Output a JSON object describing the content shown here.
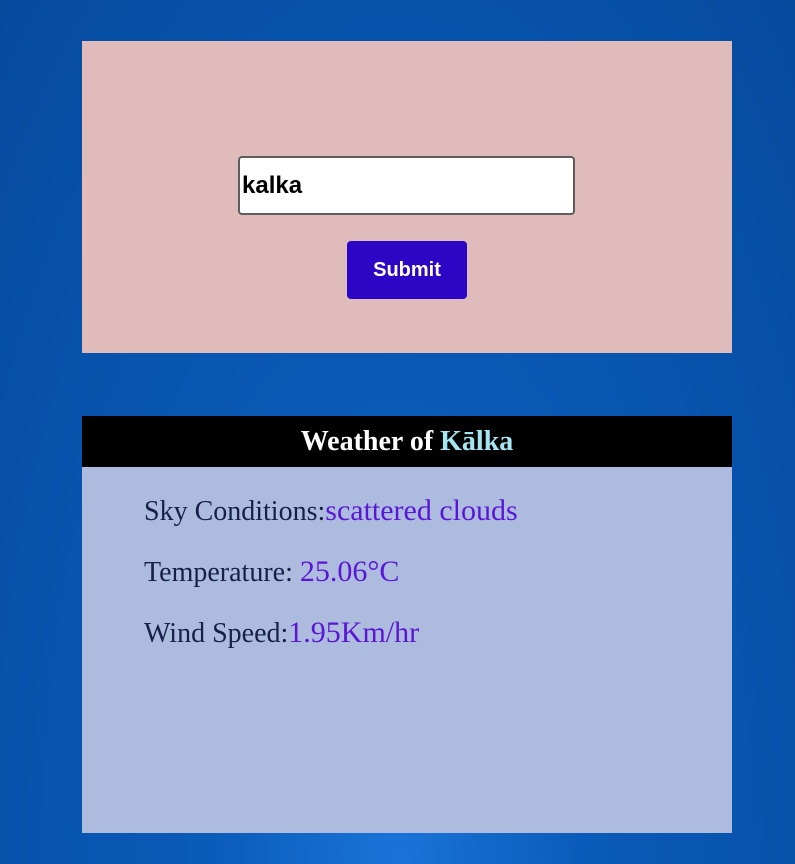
{
  "search": {
    "input_value": "kalka",
    "submit_label": "Submit"
  },
  "weather": {
    "header_prefix": "Weather of ",
    "city": "Kālka",
    "sky_label": "Sky Conditions:",
    "sky_value": "scattered clouds",
    "temp_label": "Temperature: ",
    "temp_value": "25.06°C",
    "wind_label": "Wind Speed:",
    "wind_value": "1.95Km/hr"
  },
  "colors": {
    "search_card_bg": "#dfbcbb",
    "submit_button_bg": "#2b06c4",
    "weather_card_bg": "#adbcde",
    "header_bg": "#000000",
    "city_name_color": "#a6e4f2",
    "value_color": "#5b15d6",
    "label_color": "#17204a"
  }
}
